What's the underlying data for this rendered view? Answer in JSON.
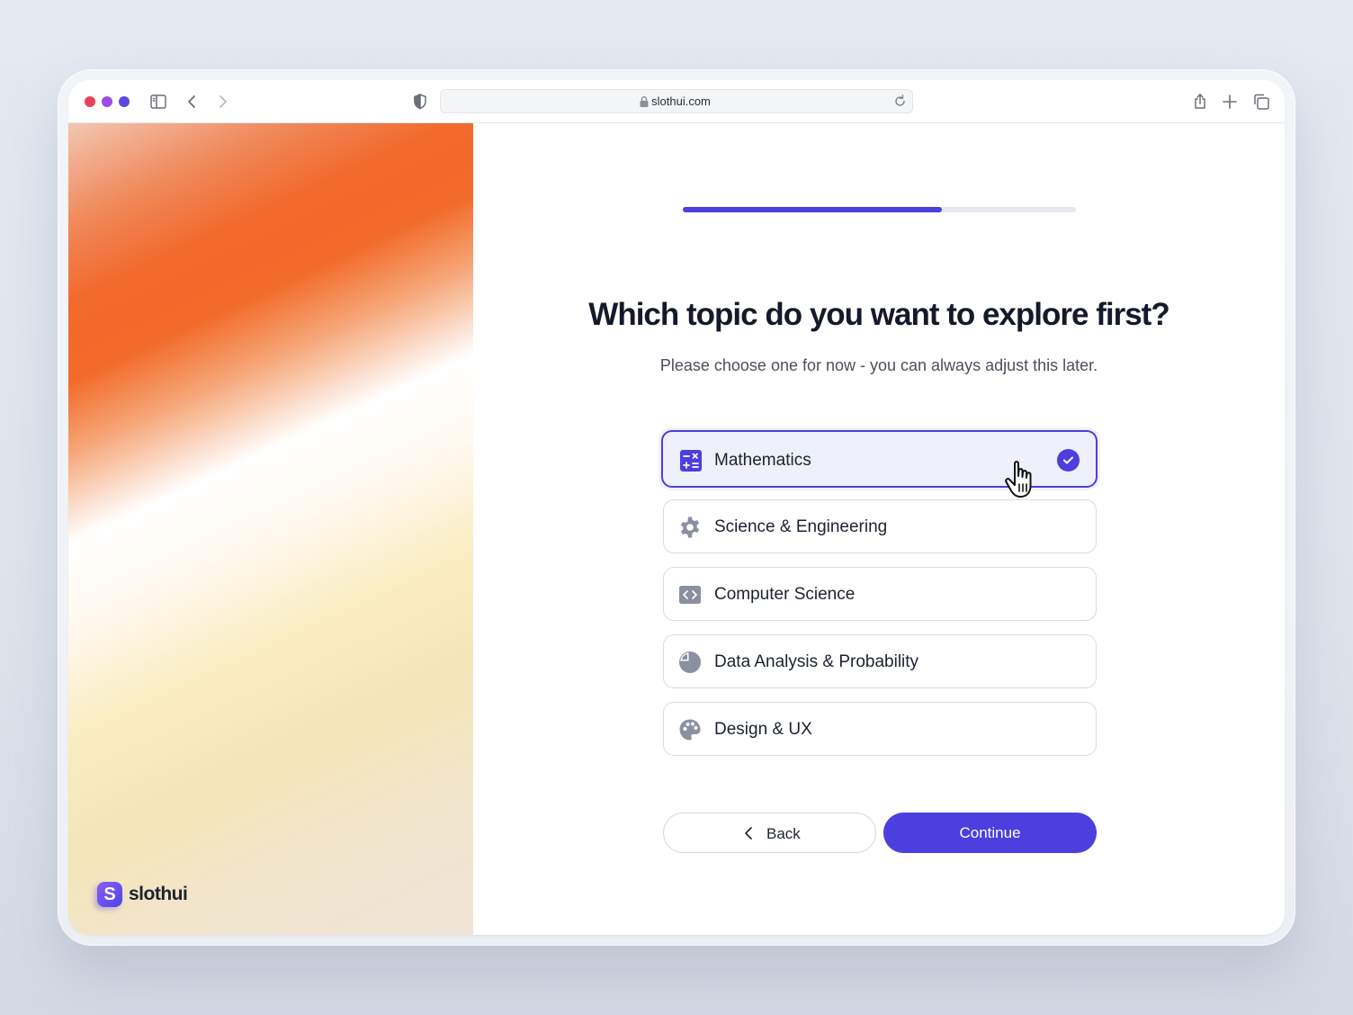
{
  "browser": {
    "url": "slothui.com",
    "icons": {
      "sidebar": "sidebar-toggle-icon",
      "back": "chevron-left-icon",
      "forward": "chevron-right-icon",
      "shield": "shield-icon",
      "lock": "lock-icon",
      "reload": "reload-icon",
      "share": "share-icon",
      "new_tab": "plus-icon",
      "tabs": "tabs-overview-icon"
    },
    "traffic_lights": [
      "#e8425a",
      "#a04be6",
      "#5a46e0"
    ]
  },
  "brand": {
    "logo_letter": "S",
    "name": "slothui"
  },
  "onboarding": {
    "progress": 0.66,
    "title": "Which topic do you want to explore first?",
    "subtitle": "Please choose one for now - you can always adjust this later.",
    "options": [
      {
        "label": "Mathematics",
        "icon": "calculator-icon",
        "selected": true
      },
      {
        "label": "Science & Engineering",
        "icon": "gear-icon",
        "selected": false
      },
      {
        "label": "Computer Science",
        "icon": "code-icon",
        "selected": false
      },
      {
        "label": "Data Analysis & Probability",
        "icon": "pie-chart-icon",
        "selected": false
      },
      {
        "label": "Design & UX",
        "icon": "palette-icon",
        "selected": false
      }
    ],
    "back_label": "Back",
    "continue_label": "Continue"
  },
  "colors": {
    "accent": "#4b3fe0",
    "selected_bg": "#eef0fc",
    "hero_orange": "#f26a2c"
  }
}
